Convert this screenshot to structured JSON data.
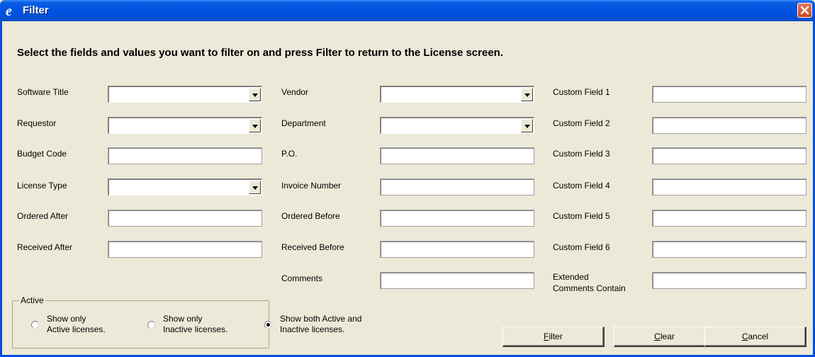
{
  "window": {
    "title": "Filter",
    "instruction": "Select the fields and values you want to filter on and press Filter to return to the License screen."
  },
  "fields": {
    "software_title": {
      "label": "Software Title",
      "value": ""
    },
    "requestor": {
      "label": "Requestor",
      "value": ""
    },
    "budget_code": {
      "label": "Budget Code",
      "value": ""
    },
    "license_type": {
      "label": "License Type",
      "value": ""
    },
    "ordered_after": {
      "label": "Ordered After",
      "value": ""
    },
    "received_after": {
      "label": "Received After",
      "value": ""
    },
    "vendor": {
      "label": "Vendor",
      "value": ""
    },
    "department": {
      "label": "Department",
      "value": ""
    },
    "po": {
      "label": "P.O.",
      "value": ""
    },
    "invoice_number": {
      "label": "Invoice Number",
      "value": ""
    },
    "ordered_before": {
      "label": "Ordered Before",
      "value": ""
    },
    "received_before": {
      "label": "Received Before",
      "value": ""
    },
    "comments": {
      "label": "Comments",
      "value": ""
    },
    "custom_field_1": {
      "label": "Custom Field 1",
      "value": ""
    },
    "custom_field_2": {
      "label": "Custom Field 2",
      "value": ""
    },
    "custom_field_3": {
      "label": "Custom Field 3",
      "value": ""
    },
    "custom_field_4": {
      "label": "Custom Field 4",
      "value": ""
    },
    "custom_field_5": {
      "label": "Custom Field 5",
      "value": ""
    },
    "custom_field_6": {
      "label": "Custom Field 6",
      "value": ""
    },
    "extended_comments": {
      "label_line1": "Extended",
      "label_line2": "Comments Contain",
      "value": ""
    }
  },
  "active_group": {
    "title": "Active",
    "options": [
      {
        "line1": "Show only",
        "line2": "Active licenses.",
        "selected": false
      },
      {
        "line1": "Show only",
        "line2": "Inactive licenses.",
        "selected": false
      },
      {
        "line1": "Show both Active and",
        "line2": "Inactive licenses.",
        "selected": true
      }
    ]
  },
  "buttons": {
    "filter": {
      "mnemonic": "F",
      "rest": "ilter"
    },
    "clear": {
      "mnemonic": "C",
      "rest": "lear"
    },
    "cancel": {
      "mnemonic": "C",
      "rest": "ancel"
    }
  },
  "colors": {
    "titlebar": "#0054E3",
    "face": "#ECE9D8",
    "close_button": "#C9441E"
  },
  "icons": {
    "app": "ie-e-icon",
    "close": "close-x-icon"
  }
}
